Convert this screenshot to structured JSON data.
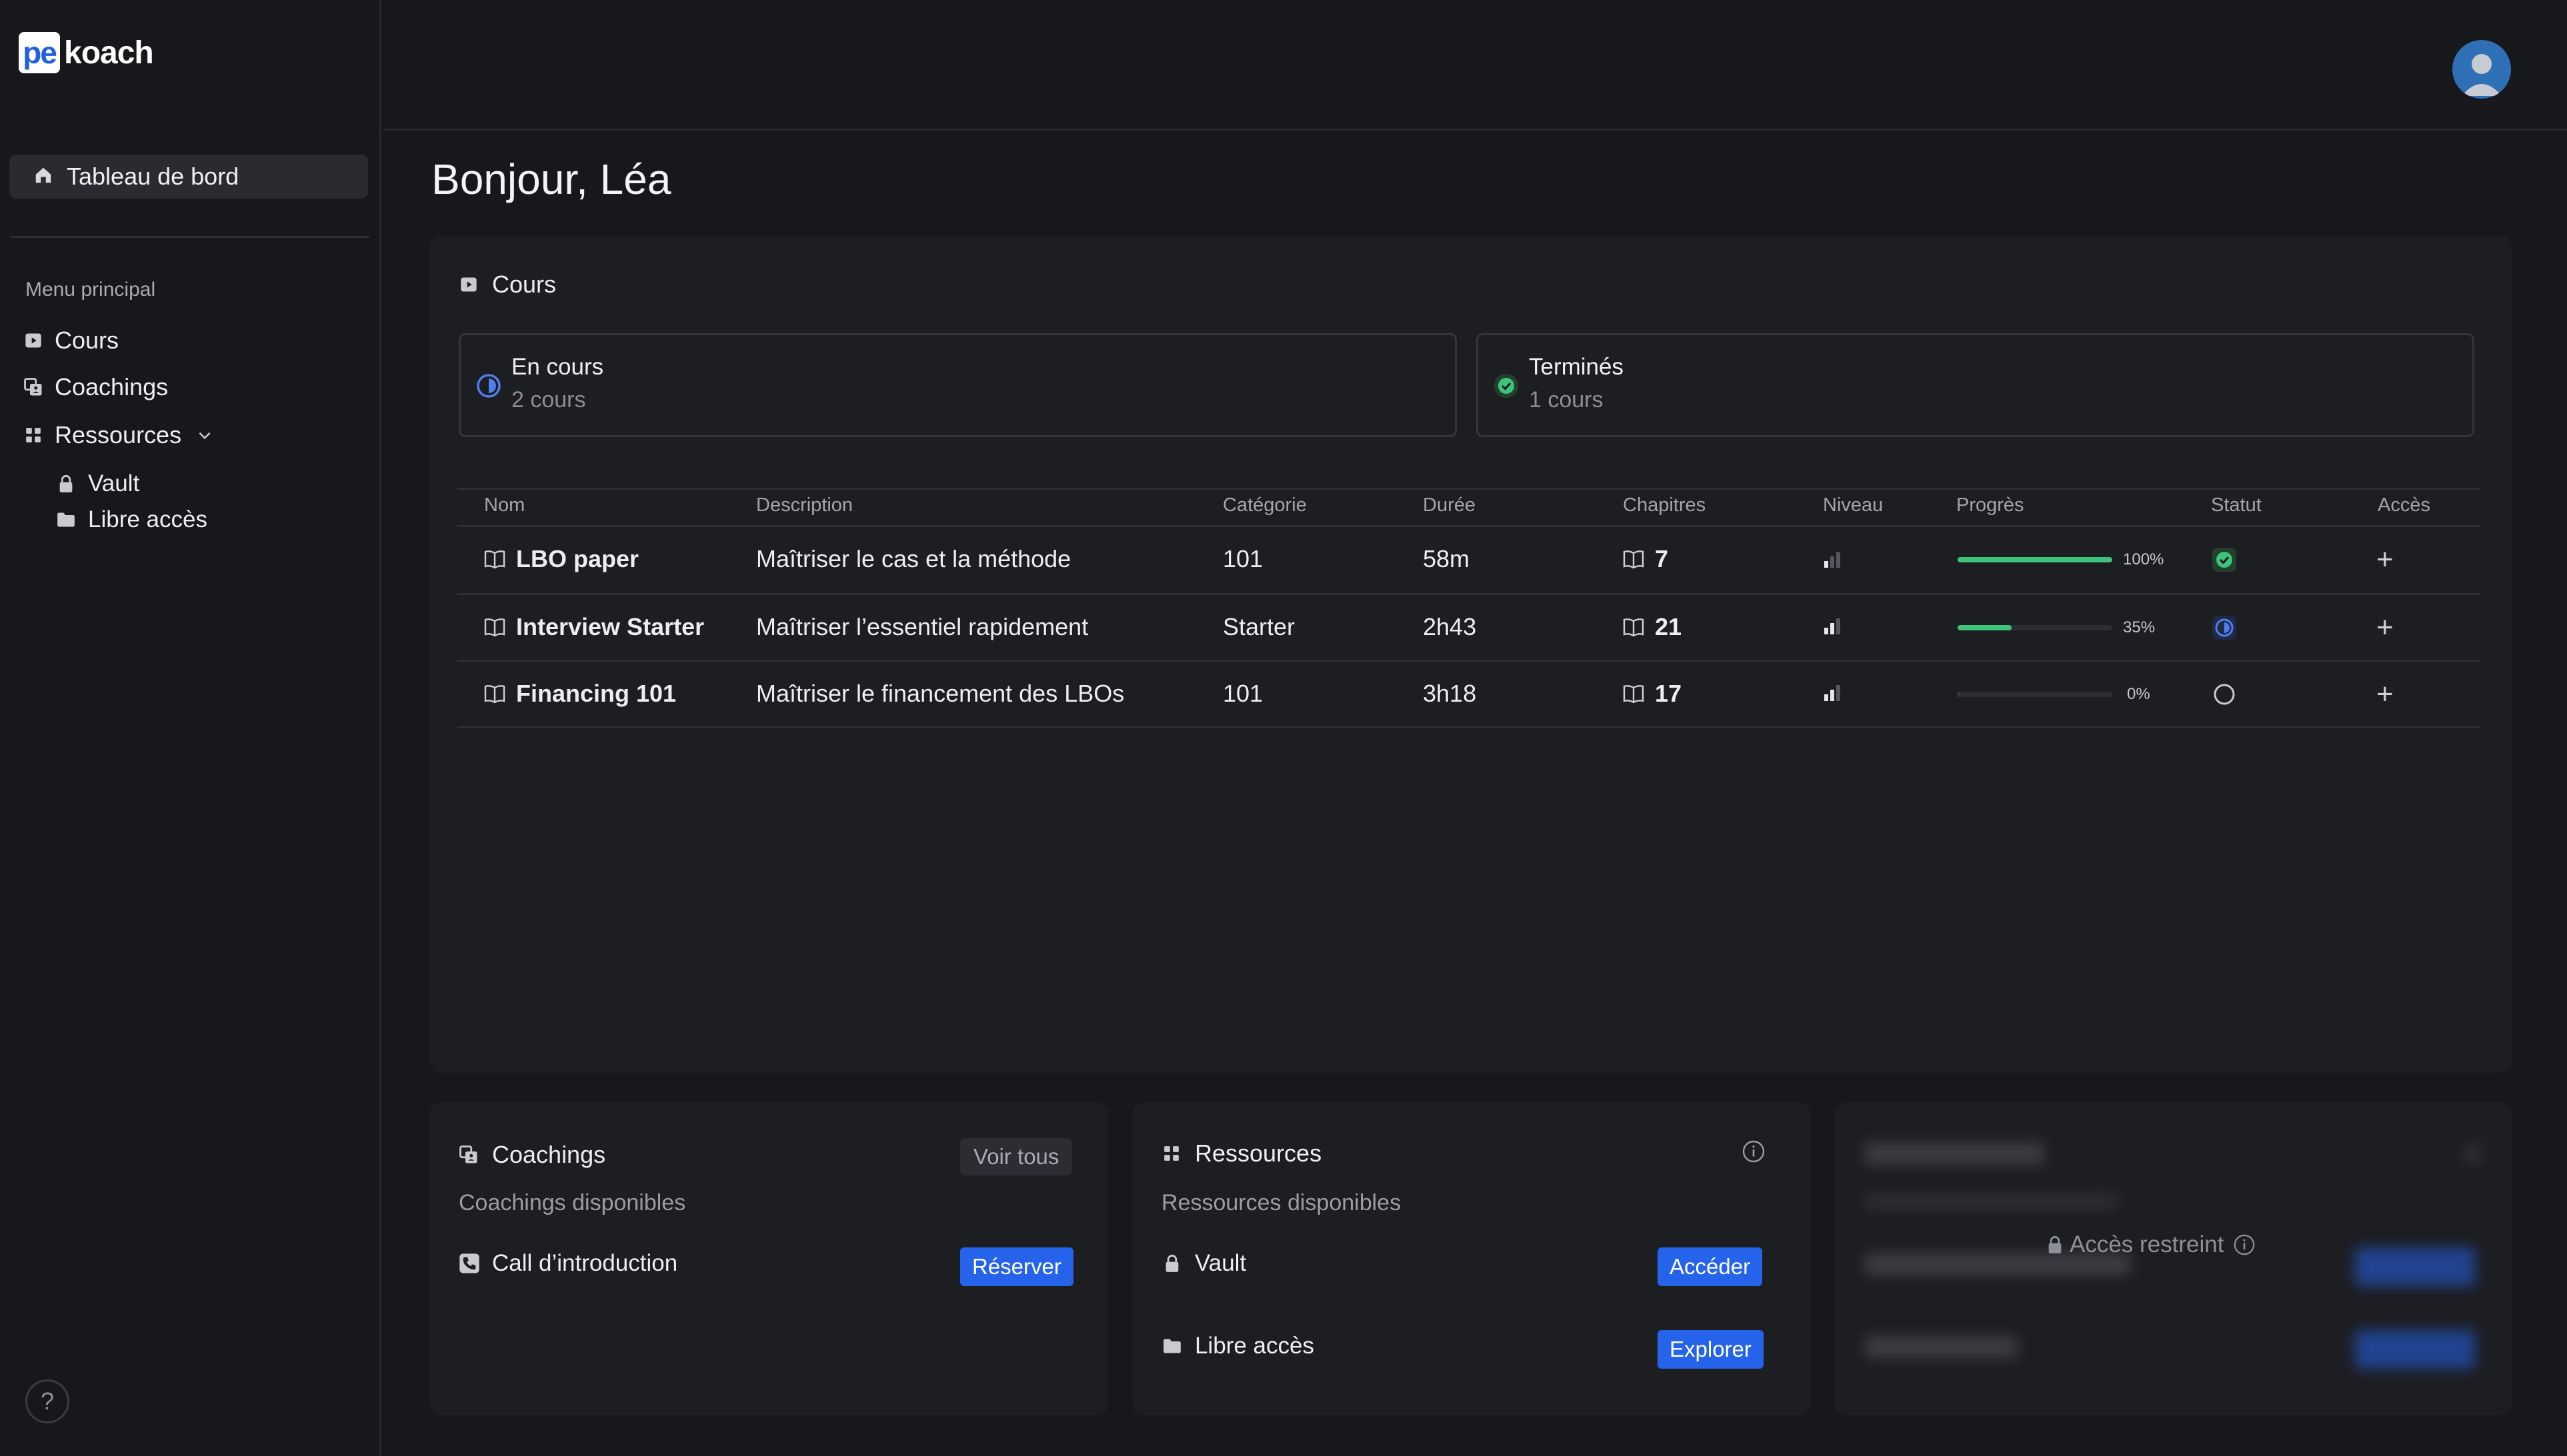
{
  "brand": {
    "logo_mark": "pe",
    "logo_text": "koach"
  },
  "sidebar": {
    "dashboard_label": "Tableau de bord",
    "menu_title": "Menu principal",
    "items": [
      {
        "label": "Cours",
        "icon": "play-square-icon"
      },
      {
        "label": "Coachings",
        "icon": "coaching-icon"
      },
      {
        "label": "Ressources",
        "icon": "grid-icon"
      }
    ],
    "sub_items": [
      {
        "label": "Vault",
        "icon": "lock-icon"
      },
      {
        "label": "Libre accès",
        "icon": "folder-icon"
      }
    ],
    "help_label": "?"
  },
  "header": {
    "greeting": "Bonjour, Léa"
  },
  "courses": {
    "title": "Cours",
    "stats": [
      {
        "label": "En cours",
        "sub": "2 cours",
        "icon": "half-circle-icon",
        "color": "#4f7ef0"
      },
      {
        "label": "Terminés",
        "sub": "1 cours",
        "icon": "check-circle-icon",
        "color": "#3ec47a"
      }
    ],
    "columns": [
      "Nom",
      "Description",
      "Catégorie",
      "Durée",
      "Chapitres",
      "Niveau",
      "Progrès",
      "Statut",
      "Accès"
    ],
    "rows": [
      {
        "name": "LBO paper",
        "description": "Maîtriser le cas et la méthode",
        "category": "101",
        "duration": "58m",
        "chapters": "7",
        "level": 1,
        "progress": 1.0,
        "progress_label": "100%",
        "status": "done"
      },
      {
        "name": "Interview Starter",
        "description": "Maîtriser l’essentiel rapidement",
        "category": "Starter",
        "duration": "2h43",
        "chapters": "21",
        "level": 2,
        "progress": 0.35,
        "progress_label": "35%",
        "status": "in-progress"
      },
      {
        "name": "Financing 101",
        "description": "Maîtriser le financement des LBOs",
        "category": "101",
        "duration": "3h18",
        "chapters": "17",
        "level": 2,
        "progress": 0.0,
        "progress_label": "0%",
        "status": "not-started"
      }
    ]
  },
  "coachings": {
    "title": "Coachings",
    "see_all": "Voir tous",
    "subtitle": "Coachings disponibles",
    "items": [
      {
        "label": "Call d’introduction",
        "action": "Réserver"
      }
    ]
  },
  "resources": {
    "title": "Ressources",
    "subtitle": "Ressources disponibles",
    "items": [
      {
        "label": "Vault",
        "action": "Accéder"
      },
      {
        "label": "Libre accès",
        "action": "Explorer"
      }
    ]
  },
  "locked": {
    "label": "Accès restreint"
  },
  "colors": {
    "accent": "#2563eb",
    "success": "#3ec47a",
    "progress_blue": "#4f7ef0",
    "background": "#17181c",
    "panel": "#1d1e22"
  }
}
